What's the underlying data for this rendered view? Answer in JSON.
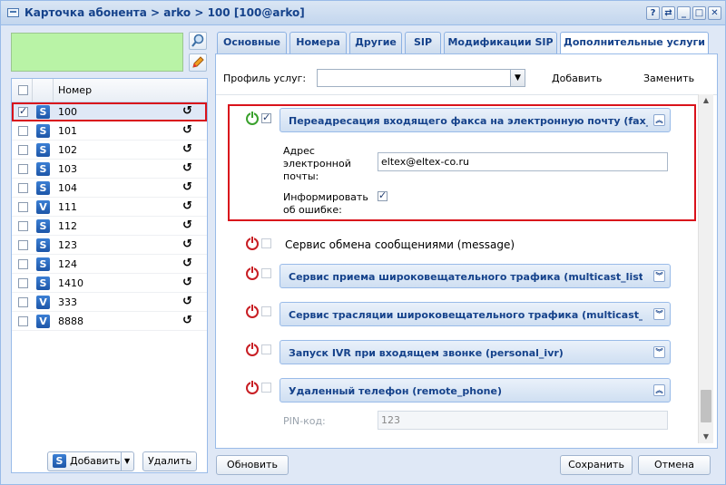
{
  "window": {
    "title": "Карточка абонента > arko > 100 [100@arko]",
    "tools": [
      "?",
      "⇄",
      "_",
      "□",
      "✕"
    ]
  },
  "left": {
    "column_header": "Номер",
    "rows": [
      {
        "type": "S",
        "number": "100",
        "checked": true
      },
      {
        "type": "S",
        "number": "101",
        "checked": false
      },
      {
        "type": "S",
        "number": "102",
        "checked": false
      },
      {
        "type": "S",
        "number": "103",
        "checked": false
      },
      {
        "type": "S",
        "number": "104",
        "checked": false
      },
      {
        "type": "V",
        "number": "111",
        "checked": false
      },
      {
        "type": "S",
        "number": "112",
        "checked": false
      },
      {
        "type": "S",
        "number": "123",
        "checked": false
      },
      {
        "type": "S",
        "number": "124",
        "checked": false
      },
      {
        "type": "S",
        "number": "1410",
        "checked": false
      },
      {
        "type": "V",
        "number": "333",
        "checked": false
      },
      {
        "type": "V",
        "number": "8888",
        "checked": false
      }
    ],
    "add_label": "Добавить",
    "delete_label": "Удалить"
  },
  "tabs": [
    "Основные",
    "Номера",
    "Другие",
    "SIP",
    "Модификации SIP",
    "Дополнительные услуги"
  ],
  "profile": {
    "label": "Профиль услуг:",
    "value": "",
    "add_label": "Добавить",
    "replace_label": "Заменить"
  },
  "services": {
    "fax": {
      "title": "Переадресация входящего факса на электронную почту (fax_",
      "email_label": "Адрес электронной почты:",
      "email_value": "eltex@eltex-co.ru",
      "inform_label": "Информировать об ошибке:"
    },
    "message": {
      "title": "Сервис обмена сообщениями (message)"
    },
    "multicast_listen": {
      "title": "Сервис приема широковещательного трафика (multicast_liste"
    },
    "multicast_play": {
      "title": "Сервис трасляции широковещательного трафика (multicast_p"
    },
    "ivr": {
      "title": "Запуск IVR при входящем звонке (personal_ivr)"
    },
    "remote_phone": {
      "title": "Удаленный телефон (remote_phone)",
      "pin_label": "PIN-код:",
      "pin_value": "123"
    }
  },
  "footer": {
    "refresh_label": "Обновить",
    "save_label": "Сохранить",
    "cancel_label": "Отмена"
  }
}
